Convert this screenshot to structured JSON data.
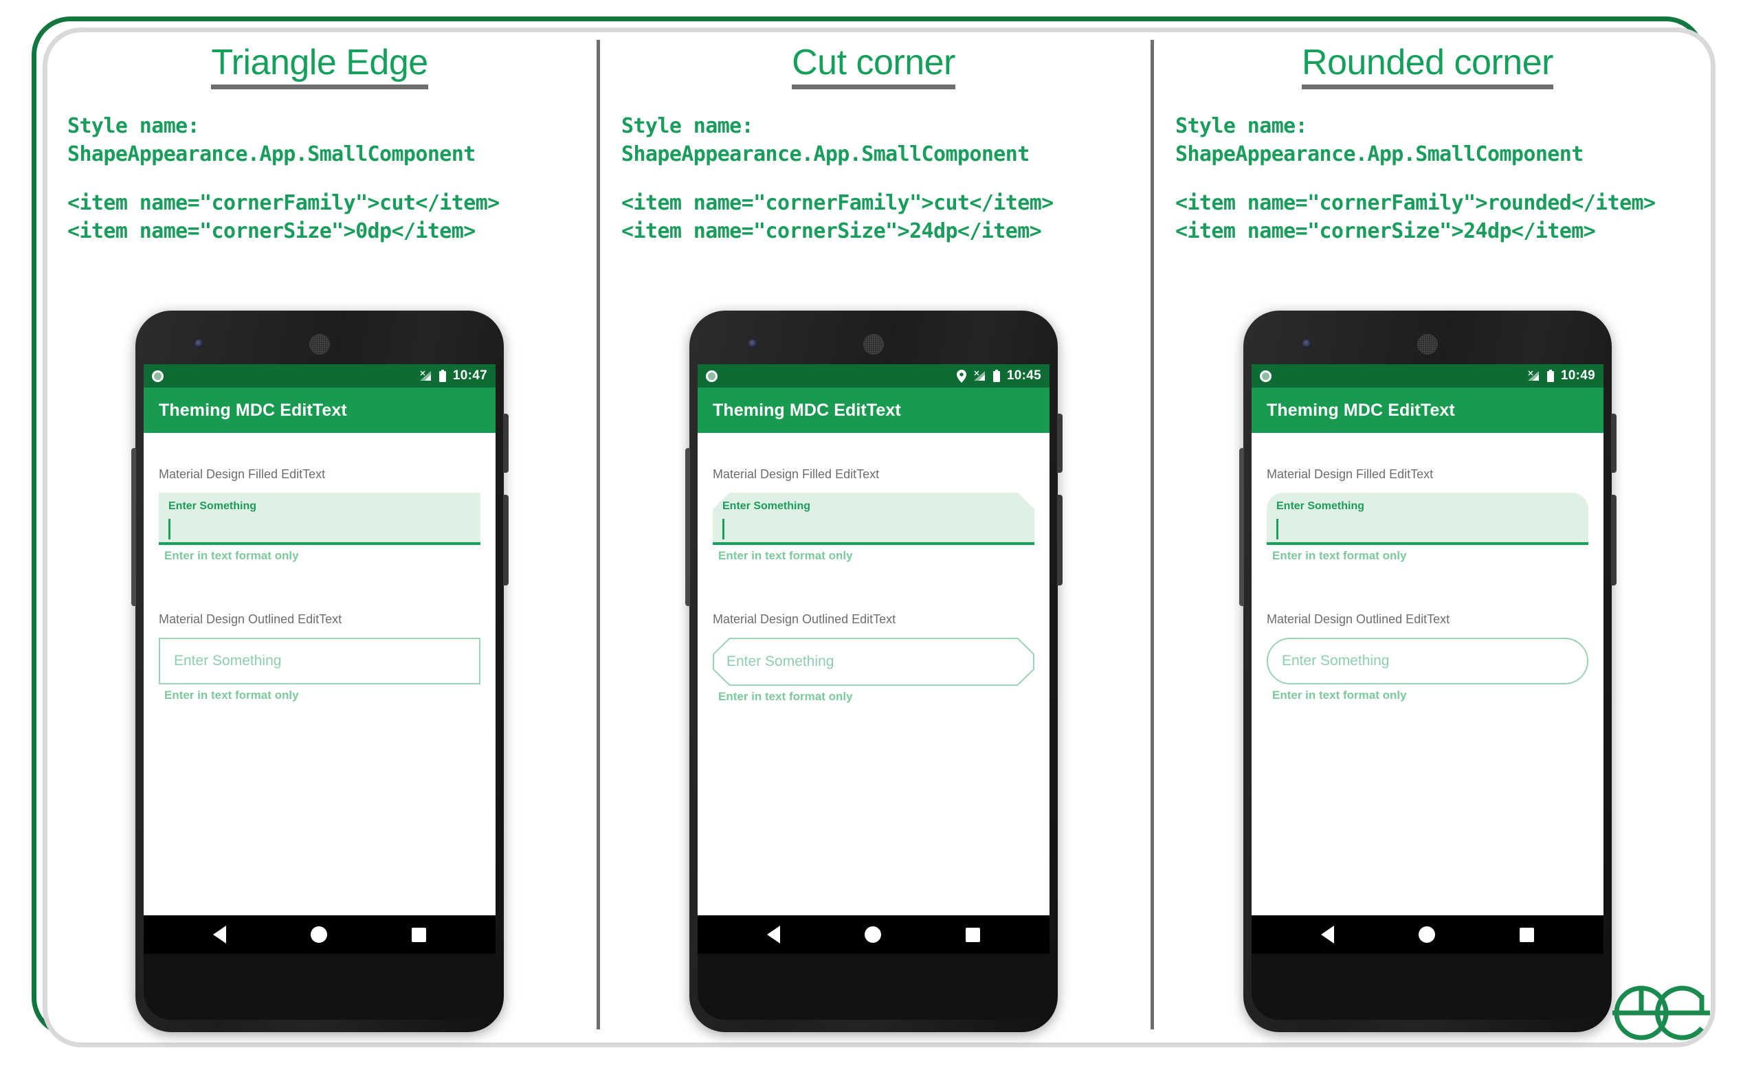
{
  "page": {
    "title": "Theming MDC EditText shape appearance comparison",
    "accent_green": "#14a05a",
    "code_green": "#1a9d5c",
    "divider_gray": "#6e6e6e",
    "frame_green": "#12773f",
    "frame_gray": "#d9d9d9"
  },
  "columns": [
    {
      "title": "Triangle Edge",
      "style_label": "Style name:",
      "style_value": "ShapeAppearance.App.SmallComponent",
      "item_corner_family": "<item name=\"cornerFamily\">cut</item>",
      "item_corner_size": "<item name=\"cornerSize\">0dp</item>",
      "phone": {
        "status": {
          "time": "10:47",
          "icons": [
            "record-dot-icon",
            "signal-icon",
            "battery-icon"
          ]
        },
        "appbar_title": "Theming MDC EditText",
        "filled": {
          "label": "Material Design Filled EditText",
          "float_label": "Enter Something",
          "helper": "Enter in text format only"
        },
        "outlined": {
          "label": "Material Design Outlined EditText",
          "placeholder": "Enter Something",
          "helper": "Enter in text format only"
        },
        "nav": [
          "back-icon",
          "home-icon",
          "recents-icon"
        ]
      }
    },
    {
      "title": "Cut corner",
      "style_label": "Style name:",
      "style_value": "ShapeAppearance.App.SmallComponent",
      "item_corner_family": "<item name=\"cornerFamily\">cut</item>",
      "item_corner_size": "<item name=\"cornerSize\">24dp</item>",
      "phone": {
        "status": {
          "time": "10:45",
          "icons": [
            "location-pin-icon",
            "signal-icon",
            "battery-icon"
          ]
        },
        "appbar_title": "Theming MDC EditText",
        "filled": {
          "label": "Material Design Filled EditText",
          "float_label": "Enter Something",
          "helper": "Enter in text format only"
        },
        "outlined": {
          "label": "Material Design Outlined EditText",
          "placeholder": "Enter Something",
          "helper": "Enter in text format only"
        },
        "nav": [
          "back-icon",
          "home-icon",
          "recents-icon"
        ]
      }
    },
    {
      "title": "Rounded corner",
      "style_label": "Style name:",
      "style_value": "ShapeAppearance.App.SmallComponent",
      "item_corner_family": "<item name=\"cornerFamily\">rounded</item>",
      "item_corner_size": "<item name=\"cornerSize\">24dp</item>",
      "phone": {
        "status": {
          "time": "10:49",
          "icons": [
            "record-dot-icon",
            "signal-icon",
            "battery-icon"
          ]
        },
        "appbar_title": "Theming MDC EditText",
        "filled": {
          "label": "Material Design Filled EditText",
          "float_label": "Enter Something",
          "helper": "Enter in text format only"
        },
        "outlined": {
          "label": "Material Design Outlined EditText",
          "placeholder": "Enter Something",
          "helper": "Enter in text format only"
        },
        "nav": [
          "back-icon",
          "home-icon",
          "recents-icon"
        ]
      }
    }
  ],
  "watermark": {
    "name": "geeksforgeeks-logo",
    "text": "ƏG"
  }
}
